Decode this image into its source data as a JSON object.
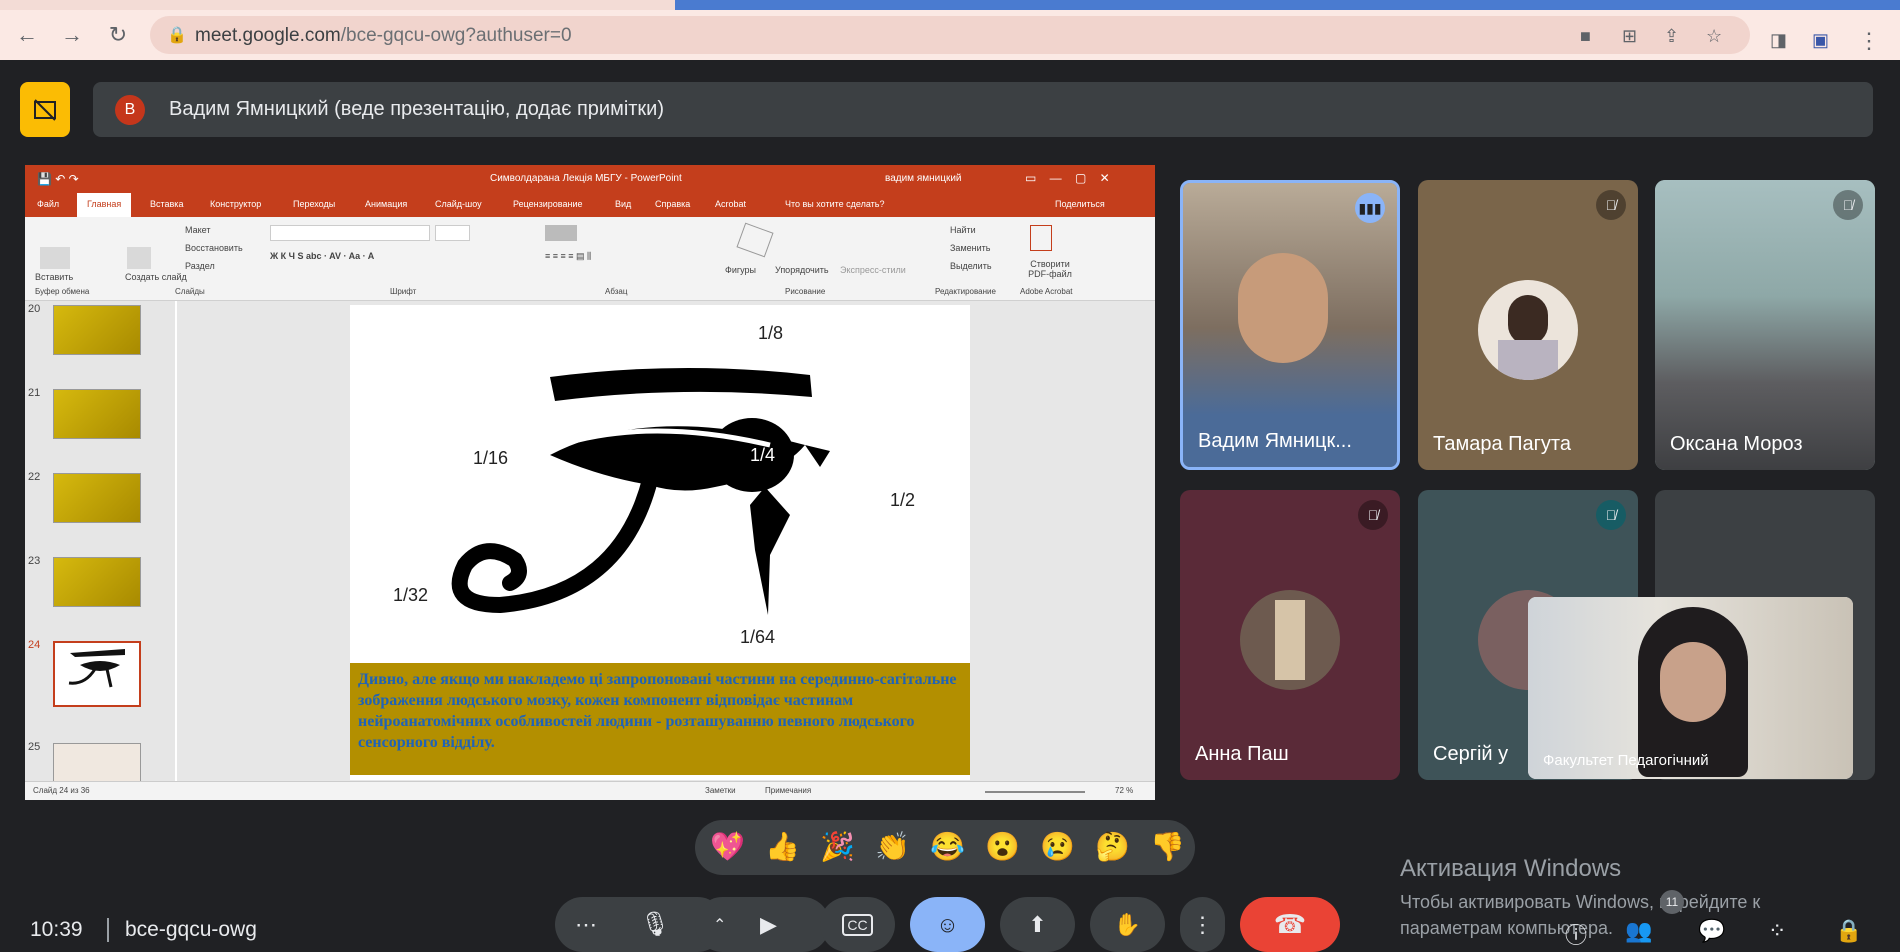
{
  "browser": {
    "url_host": "meet.google.com",
    "url_path": "/bce-gqcu-owg?authuser=0"
  },
  "meet": {
    "presenter_initial": "B",
    "presenter_label": "Вадим Ямницкий (веде презентацію, додає примітки)",
    "clock": "10:39",
    "meeting_code": "bce-gqcu-owg",
    "participants_count": "11"
  },
  "powerpoint": {
    "title": "Символдарана Лекція МБГУ - PowerPoint",
    "user": "вадим ямницкий",
    "tabs": [
      "Файл",
      "Главная",
      "Вставка",
      "Конструктор",
      "Переходы",
      "Анимация",
      "Слайд-шоу",
      "Рецензирование",
      "Вид",
      "Справка",
      "Acrobat",
      "Что вы хотите сделать?"
    ],
    "share": "Поделиться",
    "ribbon": {
      "paste": "Вставить",
      "create_slide": "Создать слайд",
      "layout": "Макет",
      "reset": "Восстановить",
      "section": "Раздел",
      "shapes": "Фигуры",
      "arrange": "Упорядочить",
      "express": "Экспресс-стили",
      "find": "Найти",
      "replace": "Заменить",
      "select": "Выделить",
      "create_pdf": "Створити PDF-файл",
      "groups": [
        "Буфер обмена",
        "Слайды",
        "Шрифт",
        "Абзац",
        "Рисование",
        "Редактирование",
        "Adobe Acrobat"
      ]
    },
    "thumbnail_numbers": [
      "20",
      "21",
      "22",
      "23",
      "24",
      "25"
    ],
    "slide_fractions": {
      "top": "1/8",
      "left": "1/16",
      "center": "1/4",
      "right": "1/2",
      "bottom_left": "1/32",
      "bottom": "1/64"
    },
    "slide_caption": "Дивно, але якщо ми накладемо ці запропоновані частини на серединно-сагітальне зображення людського мозку, кожен компонент відповідає частинам нейроанатомічних особливостей людини - розташуванню певного людського сенсорного відділу.",
    "status": {
      "slide": "Слайд 24 из 36",
      "notes": "Заметки",
      "comments": "Примечания",
      "zoom": "72 %"
    }
  },
  "participants": [
    {
      "name": "Вадим Ямницк...",
      "state": "speaking"
    },
    {
      "name": "Тамара Пагута",
      "state": "muted"
    },
    {
      "name": "Оксана Мороз",
      "state": "muted"
    },
    {
      "name": "Анна Паш",
      "state": "muted"
    },
    {
      "name": "Сергій у",
      "state": "muted"
    },
    {
      "name": "Факультет Педагогічний",
      "state": "self"
    }
  ],
  "reactions": [
    "💖",
    "👍",
    "🎉",
    "👏",
    "😂",
    "😮",
    "😢",
    "🤔",
    "👎"
  ],
  "windows": {
    "title": "Активация Windows",
    "line1": "Чтобы активировать Windows, перейдите к",
    "line2": "параметрам компьютера."
  },
  "colors": {
    "accent_yellow": "#fbbc04",
    "hangup": "#ea4335",
    "ppt_red": "#c43e1c",
    "active_ctrl": "#8ab4f8"
  }
}
